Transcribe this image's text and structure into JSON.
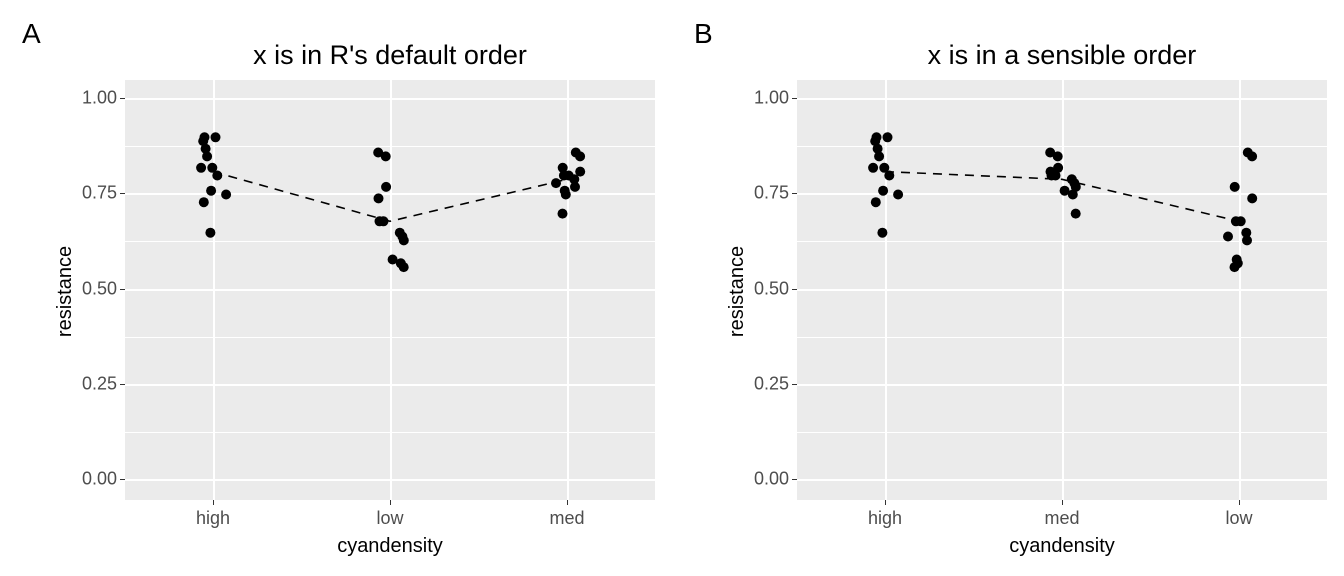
{
  "panel_labels": {
    "a": "A",
    "b": "B"
  },
  "y_ticks": [
    0.0,
    0.25,
    0.5,
    0.75,
    1.0
  ],
  "y_tick_labels": [
    "0.00",
    "0.25",
    "0.50",
    "0.75",
    "1.00"
  ],
  "axis_labels": {
    "x": "cyandensity",
    "y": "resistance"
  },
  "titles": {
    "a": "x is in R's default order",
    "b": "x is in a sensible order"
  },
  "chart_data": [
    {
      "type": "scatter",
      "panel": "A",
      "title": "x is in R's default order",
      "xlabel": "cyandensity",
      "ylabel": "resistance",
      "ylim": [
        0,
        1.05
      ],
      "categories": [
        "high",
        "low",
        "med"
      ],
      "jitter": {
        "high": [
          0.65,
          0.73,
          0.75,
          0.76,
          0.8,
          0.82,
          0.82,
          0.85,
          0.87,
          0.89,
          0.9,
          0.9
        ],
        "low": [
          0.56,
          0.57,
          0.58,
          0.63,
          0.64,
          0.65,
          0.68,
          0.68,
          0.74,
          0.77,
          0.85,
          0.86
        ],
        "med": [
          0.7,
          0.75,
          0.76,
          0.77,
          0.78,
          0.79,
          0.8,
          0.8,
          0.81,
          0.82,
          0.85,
          0.86
        ]
      },
      "line_means": [
        0.81,
        0.68,
        0.79
      ]
    },
    {
      "type": "scatter",
      "panel": "B",
      "title": "x is in a sensible order",
      "xlabel": "cyandensity",
      "ylabel": "resistance",
      "ylim": [
        0,
        1.05
      ],
      "categories": [
        "high",
        "med",
        "low"
      ],
      "jitter": {
        "high": [
          0.65,
          0.73,
          0.75,
          0.76,
          0.8,
          0.82,
          0.82,
          0.85,
          0.87,
          0.89,
          0.9,
          0.9
        ],
        "med": [
          0.7,
          0.75,
          0.76,
          0.77,
          0.78,
          0.79,
          0.8,
          0.8,
          0.81,
          0.82,
          0.85,
          0.86
        ],
        "low": [
          0.56,
          0.57,
          0.58,
          0.63,
          0.64,
          0.65,
          0.68,
          0.68,
          0.74,
          0.77,
          0.85,
          0.86
        ]
      },
      "line_means": [
        0.81,
        0.79,
        0.68
      ]
    }
  ]
}
